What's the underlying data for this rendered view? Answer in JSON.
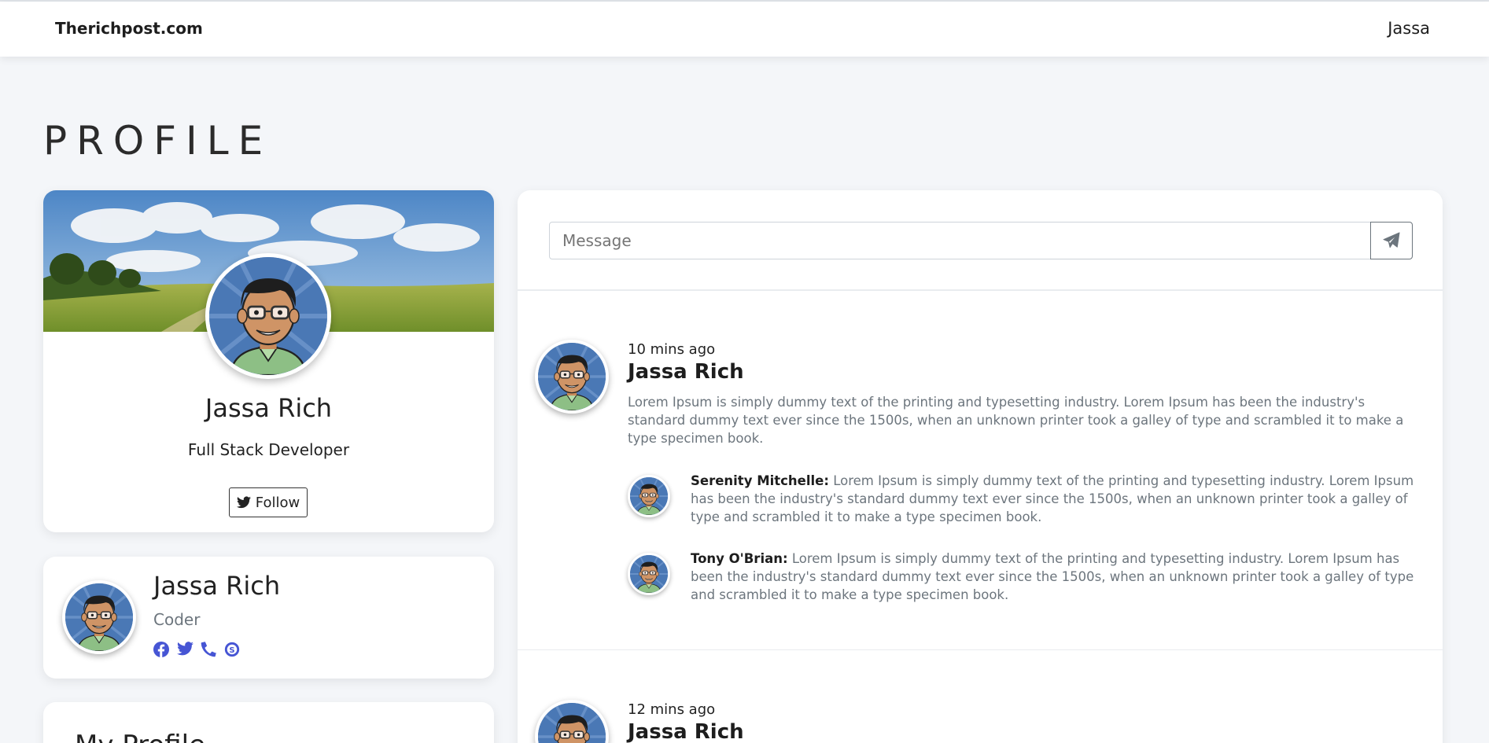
{
  "navbar": {
    "brand": "Therichpost.com",
    "user": "Jassa"
  },
  "page": {
    "title": "PROFILE"
  },
  "profile_card": {
    "name": "Jassa Rich",
    "role": "Full Stack Developer",
    "follow_label": "Follow"
  },
  "mini_card": {
    "name": "Jassa Rich",
    "role": "Coder",
    "icons": [
      "facebook-icon",
      "twitter-icon",
      "phone-icon",
      "skype-icon"
    ]
  },
  "bottom_card": {
    "title": "My Profile"
  },
  "feed": {
    "message_placeholder": "Message",
    "posts": [
      {
        "time": "10 mins ago",
        "author": "Jassa Rich",
        "body": "Lorem Ipsum is simply dummy text of the printing and typesetting industry. Lorem Ipsum has been the industry's standard dummy text ever since the 1500s, when an unknown printer took a galley of type and scrambled it to make a type specimen book.",
        "replies": [
          {
            "author": "Serenity Mitchelle:",
            "text": "Lorem Ipsum is simply dummy text of the printing and typesetting industry. Lorem Ipsum has been the industry's standard dummy text ever since the 1500s, when an unknown printer took a galley of type and scrambled it to make a type specimen book."
          },
          {
            "author": "Tony O'Brian:",
            "text": "Lorem Ipsum is simply dummy text of the printing and typesetting industry. Lorem Ipsum has been the industry's standard dummy text ever since the 1500s, when an unknown printer took a galley of type and scrambled it to make a type specimen book."
          }
        ]
      },
      {
        "time": "12 mins ago",
        "author": "Jassa Rich"
      }
    ]
  },
  "colors": {
    "accent": "#4655d4",
    "background": "#f4f6f9",
    "muted": "#6c757d"
  }
}
